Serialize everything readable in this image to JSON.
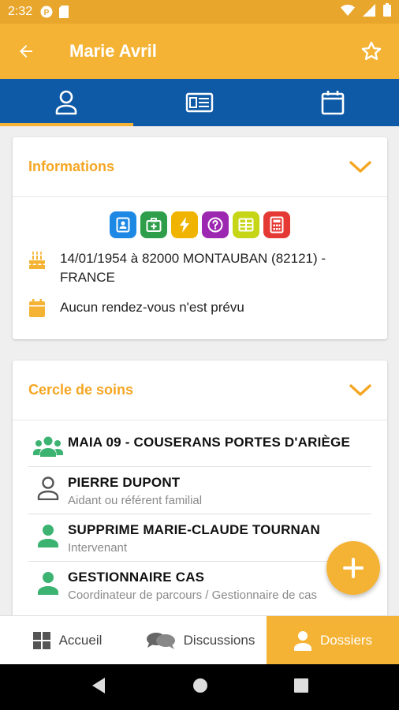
{
  "status_bar": {
    "time": "2:32"
  },
  "app_bar": {
    "title": "Marie Avril"
  },
  "tabs": [
    {
      "icon": "person-icon",
      "active": true
    },
    {
      "icon": "id-card-icon",
      "active": false
    },
    {
      "icon": "calendar-icon",
      "active": false
    }
  ],
  "info_card": {
    "title": "Informations",
    "badges": [
      {
        "icon": "contact-card-icon",
        "color": "#1e88e5"
      },
      {
        "icon": "medical-kit-icon",
        "color": "#2e9e4a"
      },
      {
        "icon": "lightning-icon",
        "color": "#f0b400"
      },
      {
        "icon": "question-icon",
        "color": "#9c27b0"
      },
      {
        "icon": "grid-icon",
        "color": "#c6d617"
      },
      {
        "icon": "calculator-icon",
        "color": "#e53935"
      }
    ],
    "birth": "14/01/1954 à 82000 MONTAUBAN (82121) - FRANCE",
    "appointment": "Aucun rendez-vous n'est prévu"
  },
  "care_card": {
    "title": "Cercle de soins",
    "members": [
      {
        "name": "MAIA 09 - COUSERANS PORTES D'ARIÈGE",
        "role": "",
        "icon": "group-icon"
      },
      {
        "name": "PIERRE DUPONT",
        "role": "Aidant ou référent familial",
        "icon": "person-outline-icon"
      },
      {
        "name": "SUPPRIME MARIE-CLAUDE TOURNAN",
        "role": "Intervenant",
        "icon": "person-icon"
      },
      {
        "name": "GESTIONNAIRE CAS",
        "role": "Coordinateur de parcours / Gestionnaire de cas",
        "icon": "person-icon"
      }
    ]
  },
  "bottom_nav": {
    "home": "Accueil",
    "discussions": "Discussions",
    "files": "Dossiers"
  },
  "colors": {
    "accent": "#f5b335",
    "tab_bar": "#0f5aa6",
    "title_text": "#f5a623",
    "green": "#3cb371"
  }
}
